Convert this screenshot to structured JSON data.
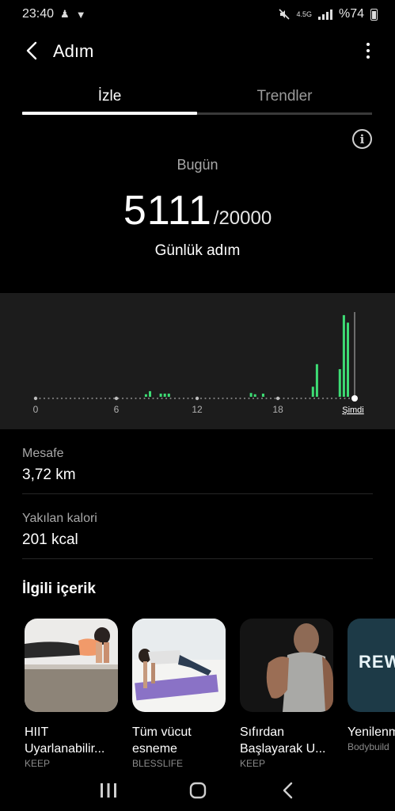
{
  "status_bar": {
    "time": "23:40",
    "network": "4.5G",
    "battery": "%74"
  },
  "app_bar": {
    "title": "Adım"
  },
  "tabs": [
    {
      "label": "İzle",
      "active": true
    },
    {
      "label": "Trendler",
      "active": false
    }
  ],
  "summary": {
    "today_label": "Bugün",
    "steps": "5111",
    "goal": "/20000",
    "daily_label": "Günlük adım"
  },
  "chart_data": {
    "type": "bar",
    "x_tick_labels": [
      "0",
      "6",
      "12",
      "18",
      "Şimdi"
    ],
    "x_ticks_hours": [
      0,
      6,
      12,
      18,
      23.7
    ],
    "xlim": [
      0,
      24
    ],
    "bar_color": "#3ddc74",
    "series": [
      {
        "hours": [
          8.2,
          8.5,
          9.3,
          9.6,
          9.9,
          16.0,
          16.3,
          16.9,
          20.6,
          20.9,
          22.6,
          22.9,
          23.2
        ],
        "values": [
          40,
          90,
          50,
          50,
          50,
          60,
          40,
          50,
          160,
          520,
          440,
          1300,
          1180
        ]
      }
    ]
  },
  "stats": {
    "distance_label": "Mesafe",
    "distance_value": "3,72 km",
    "calories_label": "Yakılan kalori",
    "calories_value": "201 kcal"
  },
  "related": {
    "title": "İlgili içerik",
    "cards": [
      {
        "title": "HIIT",
        "title2": "Uyarlanabilir...",
        "source": "KEEP"
      },
      {
        "title": "Tüm vücut",
        "title2": "esneme",
        "source": "BLESSLIFE"
      },
      {
        "title": "Sıfırdan",
        "title2": "Başlayarak U...",
        "source": "KEEP"
      },
      {
        "title": "Yenilenm",
        "title2": "",
        "source": "Bodybuild",
        "thumb_text": "REWI"
      }
    ]
  }
}
